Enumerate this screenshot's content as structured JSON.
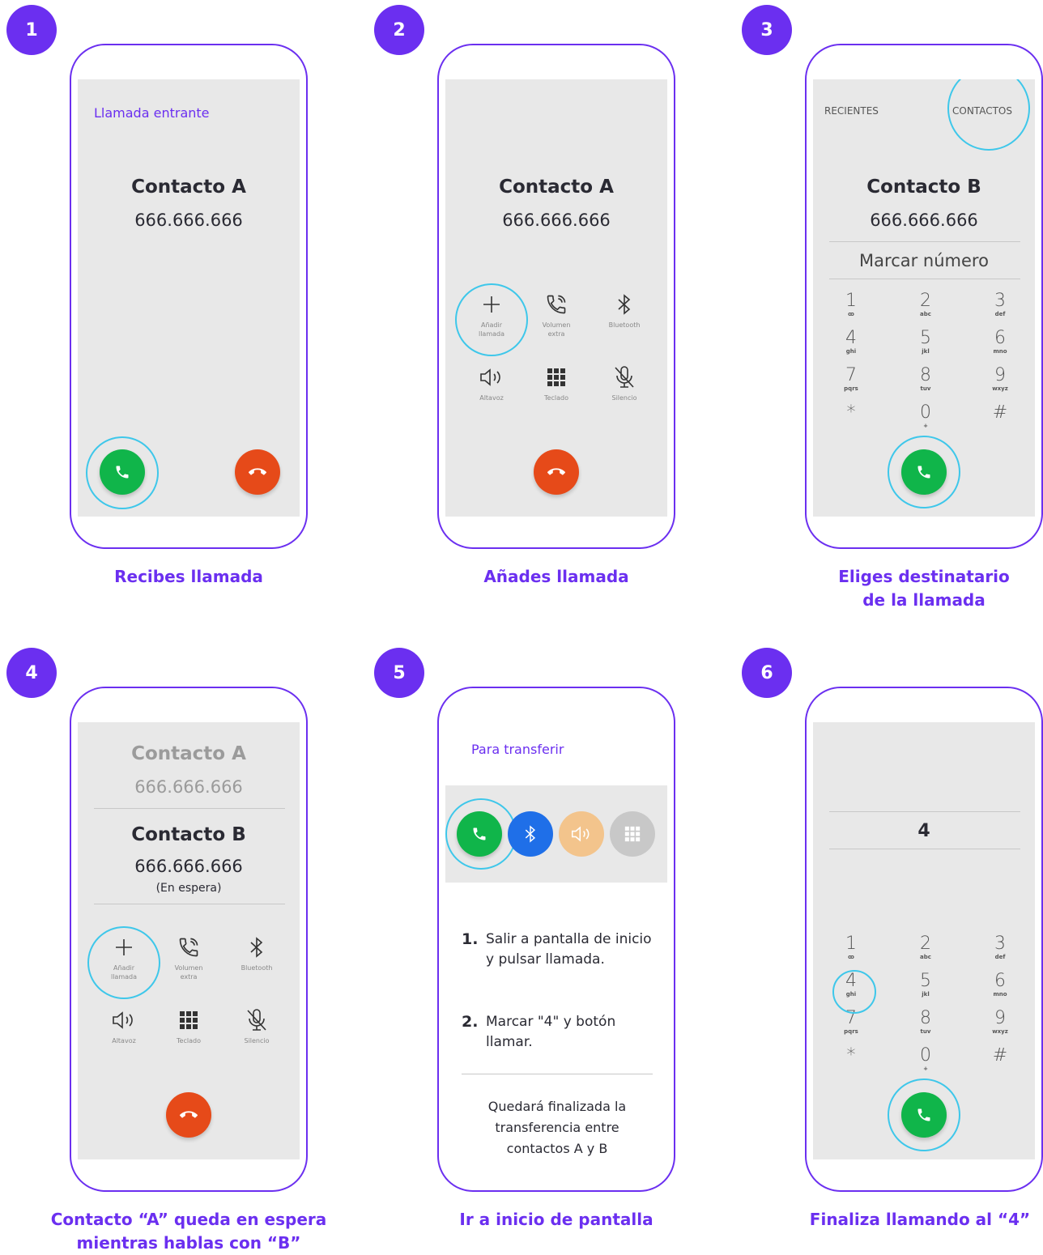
{
  "colors": {
    "accent": "#6b2ff0",
    "ring": "#3ec7ea",
    "green": "#10b54a",
    "red": "#e64a19",
    "blue": "#1f6fe8",
    "peach": "#f3c48c",
    "grey": "#c8c8c8"
  },
  "panels": [
    {
      "number": "1",
      "caption": "Recibes llamada",
      "header": "Llamada entrante",
      "contact_name": "Contacto A",
      "contact_number": "666.666.666"
    },
    {
      "number": "2",
      "caption": "Añades llamada",
      "contact_name": "Contacto A",
      "contact_number": "666.666.666",
      "controls": [
        {
          "icon": "plus-icon",
          "label_1": "Añadir",
          "label_2": "llamada"
        },
        {
          "icon": "phone-volume-icon",
          "label_1": "Volumen",
          "label_2": "extra"
        },
        {
          "icon": "bluetooth-icon",
          "label_1": "Bluetooth",
          "label_2": ""
        },
        {
          "icon": "speaker-icon",
          "label_1": "Altavoz",
          "label_2": ""
        },
        {
          "icon": "keypad-icon",
          "label_1": "Teclado",
          "label_2": ""
        },
        {
          "icon": "mute-icon",
          "label_1": "Silencio",
          "label_2": ""
        }
      ]
    },
    {
      "number": "3",
      "caption_1": "Eliges destinatario",
      "caption_2": "de la llamada",
      "tab_recents": "RECIENTES",
      "tab_contacts": "CONTACTOS",
      "contact_name": "Contacto B",
      "contact_number": "666.666.666",
      "dial_label": "Marcar número"
    },
    {
      "number": "4",
      "caption_1": "Contacto “A” queda en espera",
      "caption_2": "mientras hablas con “B”",
      "held_name": "Contacto A",
      "held_number": "666.666.666",
      "contact_name": "Contacto B",
      "contact_number": "666.666.666",
      "status": "(En espera)"
    },
    {
      "number": "5",
      "caption": "Ir a inicio de pantalla",
      "header": "Para transferir",
      "step1_num": "1.",
      "step1_text": "Salir a pantalla de inicio y pulsar llamada.",
      "step2_num": "2.",
      "step2_text": "Marcar \"4\" y botón llamar.",
      "footer": "Quedará finalizada la transferencia entre contactos A y B"
    },
    {
      "number": "6",
      "caption": "Finaliza llamando al “4”",
      "dialed": "4"
    }
  ],
  "keypad": [
    {
      "d": "1",
      "l": "ꝏ"
    },
    {
      "d": "2",
      "l": "abc"
    },
    {
      "d": "3",
      "l": "def"
    },
    {
      "d": "4",
      "l": "ghi"
    },
    {
      "d": "5",
      "l": "jkl"
    },
    {
      "d": "6",
      "l": "mno"
    },
    {
      "d": "7",
      "l": "pqrs"
    },
    {
      "d": "8",
      "l": "tuv"
    },
    {
      "d": "9",
      "l": "wxyz"
    },
    {
      "d": "*",
      "l": ""
    },
    {
      "d": "0",
      "l": "+"
    },
    {
      "d": "#",
      "l": ""
    }
  ]
}
